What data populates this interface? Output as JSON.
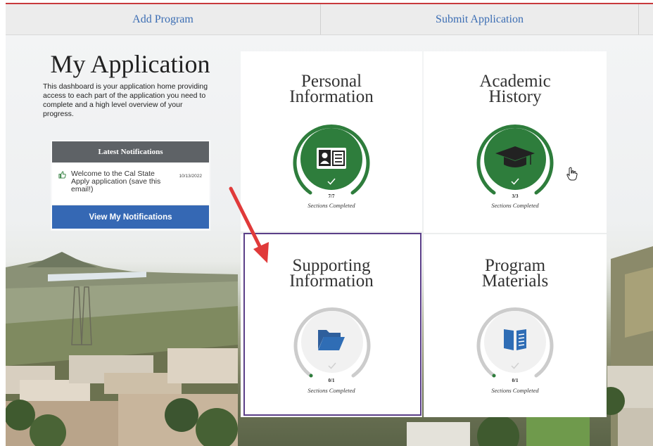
{
  "nav": {
    "add_program": "Add Program",
    "submit_application": "Submit Application"
  },
  "page": {
    "title": "My Application",
    "description": "This dashboard is your application home providing access to each part of the application you need to complete and a high level overview of your progress."
  },
  "notifications": {
    "header": "Latest Notifications",
    "items": [
      {
        "text": "Welcome to the Cal State Apply application (save this email!)",
        "date": "10/13/2022"
      }
    ],
    "button": "View My Notifications"
  },
  "tiles": [
    {
      "title_line1": "Personal",
      "title_line2": "Information",
      "count": "7/7",
      "status": "Sections Completed",
      "icon": "id-card-icon",
      "complete": true
    },
    {
      "title_line1": "Academic",
      "title_line2": "History",
      "count": "3/3",
      "status": "Sections Completed",
      "icon": "graduation-cap-icon",
      "complete": true
    },
    {
      "title_line1": "Supporting",
      "title_line2": "Information",
      "count": "0/1",
      "status": "Sections Completed",
      "icon": "folder-icon",
      "complete": false
    },
    {
      "title_line1": "Program",
      "title_line2": "Materials",
      "count": "0/1",
      "status": "Sections Completed",
      "icon": "book-icon",
      "complete": false
    }
  ],
  "colors": {
    "accent": "#3568b4",
    "complete": "#2e7d3c",
    "incomplete": "#cccccc",
    "highlight": "#5b3f88",
    "arrow": "#e03a3a"
  }
}
